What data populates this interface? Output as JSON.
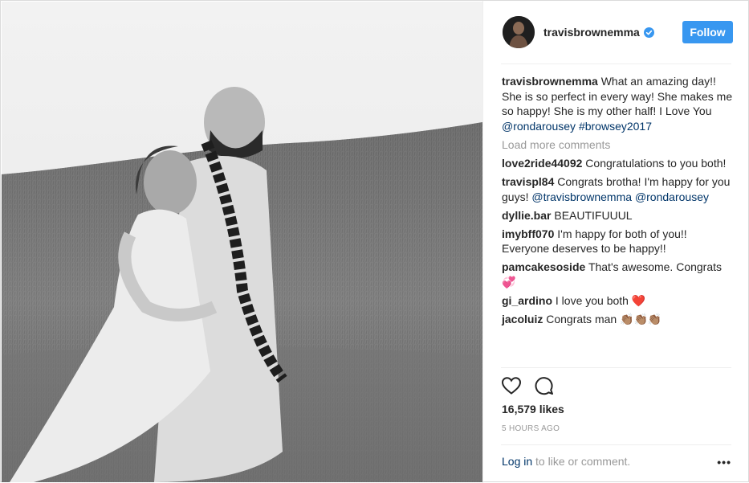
{
  "post": {
    "username": "travisbrownemma",
    "follow_label": "Follow",
    "caption_username": "travisbrownemma",
    "caption_text": "What an amazing day!! She is so perfect in every way! She makes me so happy! She is my other half! I Love You ",
    "caption_mention": "@rondarousey",
    "caption_hashtag": "#browsey2017",
    "load_more": "Load more comments",
    "likes": "16,579 likes",
    "time": "5 HOURS AGO",
    "login_link": "Log in",
    "login_text": " to like or comment.",
    "more_label": "•••"
  },
  "comments": [
    {
      "user": "love2ride44092",
      "text": "Congratulations to you both!"
    },
    {
      "user": "travispl84",
      "text": "Congrats brotha! I'm happy for you guys! ",
      "mention1": "@travisbrownemma",
      "mention2": "@rondarousey"
    },
    {
      "user": "dyllie.bar",
      "text": "BEAUTIFUUUL"
    },
    {
      "user": "imybff070",
      "text": "I'm happy for both of you!! Everyone deserves to be happy!!"
    },
    {
      "user": "pamcakesoside",
      "text": "That's awesome. Congrats 💞"
    },
    {
      "user": "gi_ardino",
      "text": "I love you both ❤️"
    },
    {
      "user": "jacoluiz",
      "text": "Congrats man 👏🏽👏🏽👏🏽"
    }
  ],
  "colors": {
    "accent": "#3897f0",
    "link": "#003569",
    "muted": "#999999"
  }
}
